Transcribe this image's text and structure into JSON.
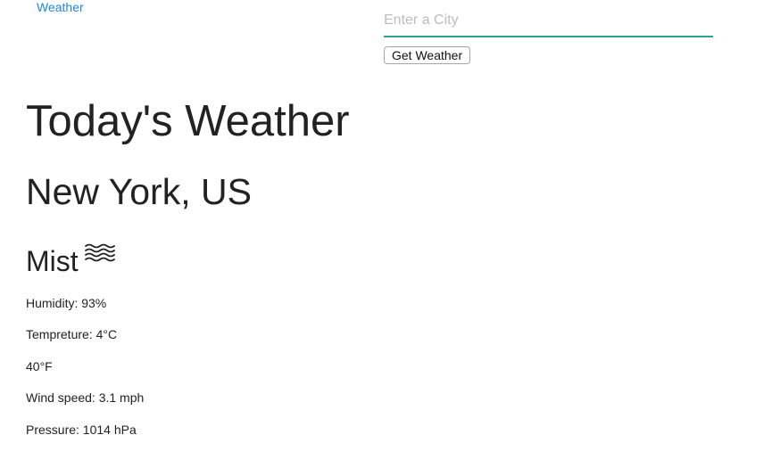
{
  "nav": {
    "weather_link": "Weather"
  },
  "search": {
    "placeholder": "Enter a City",
    "value": ""
  },
  "button": {
    "get_weather": "Get Weather"
  },
  "weather": {
    "heading": "Today's Weather",
    "location": "New York, US",
    "condition": "Mist",
    "condition_icon": "mist-icon",
    "humidity": "Humidity: 93%",
    "temperature_c": "Tempreture: 4°C",
    "temperature_f": "40°F",
    "wind": "Wind speed: 3.1 mph",
    "pressure": "Pressure: 1014 hPa"
  },
  "colors": {
    "link": "#1e88e5",
    "input_underline": "#26a69a",
    "text": "#222222"
  }
}
